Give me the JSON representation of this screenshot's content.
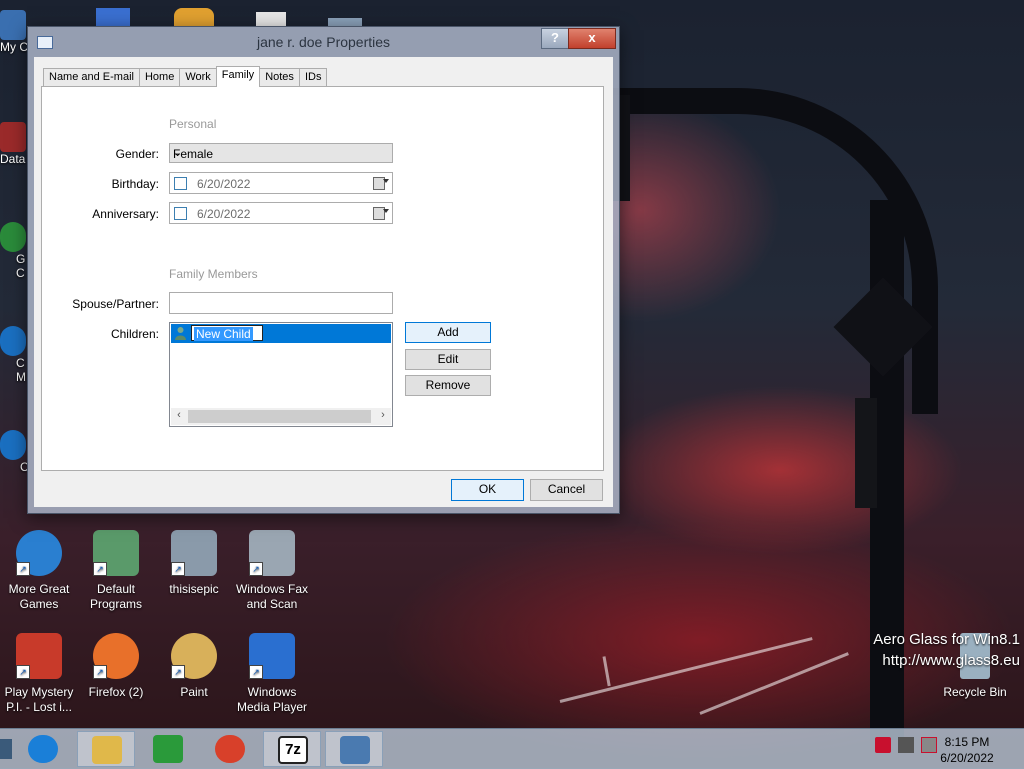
{
  "window": {
    "title": "jane r. doe Properties",
    "help_label": "?",
    "close_label": "x"
  },
  "tabs": [
    {
      "label": "Name and E-mail"
    },
    {
      "label": "Home"
    },
    {
      "label": "Work"
    },
    {
      "label": "Family"
    },
    {
      "label": "Notes"
    },
    {
      "label": "IDs"
    }
  ],
  "active_tab": "Family",
  "personal": {
    "section_label": "Personal",
    "gender_label": "Gender:",
    "gender_value": "Female",
    "birthday_label": "Birthday:",
    "birthday_value": "6/20/2022",
    "anniversary_label": "Anniversary:",
    "anniversary_value": "6/20/2022"
  },
  "family": {
    "section_label": "Family Members",
    "spouse_label": "Spouse/Partner:",
    "spouse_value": "",
    "children_label": "Children:",
    "children": [
      "New Child"
    ],
    "add_label": "Add",
    "edit_label": "Edit",
    "remove_label": "Remove"
  },
  "footer": {
    "ok_label": "OK",
    "cancel_label": "Cancel"
  },
  "desktop_icons": [
    {
      "label": "My C",
      "color": "#3a6fb0"
    },
    {
      "label": "Data",
      "color": "#9a2a2a"
    },
    {
      "label": "G\nC",
      "color": "#2a8a3a"
    },
    {
      "label": "C\nM",
      "color": "#1a6fc0"
    },
    {
      "label": "C",
      "color": "#1a6fc0"
    },
    {
      "label": "More Great Games",
      "color": "#2a7fd0"
    },
    {
      "label": "Default Programs",
      "color": "#5a9a6a"
    },
    {
      "label": "thisisepic",
      "color": "#8a9aaa"
    },
    {
      "label": "Windows Fax and Scan",
      "color": "#9aa6b2"
    },
    {
      "label": "Play Mystery P.I. - Lost i...",
      "color": "#c83a2a"
    },
    {
      "label": "Firefox (2)",
      "color": "#e8702a"
    },
    {
      "label": "Paint",
      "color": "#d8b05a"
    },
    {
      "label": "Windows Media Player",
      "color": "#2a6fd0"
    },
    {
      "label": "Recycle Bin",
      "color": "#9ab0c0"
    }
  ],
  "watermark": {
    "line1": "Aero Glass for Win8.1",
    "line2": "http://www.glass8.eu"
  },
  "taskbar": {
    "apps": [
      {
        "name": "Internet Explorer",
        "color": "#1a7fd8"
      },
      {
        "name": "File Explorer",
        "color": "#e0b84a"
      },
      {
        "name": "Store",
        "color": "#2a9a3a"
      },
      {
        "name": "Chrome",
        "color": "#d8402a"
      },
      {
        "name": "7-Zip",
        "color": "#222222"
      },
      {
        "name": "Address Book",
        "color": "#4a7ab0"
      }
    ],
    "seven_zip_text": "7z",
    "time": "8:15 PM",
    "date": "6/20/2022"
  }
}
